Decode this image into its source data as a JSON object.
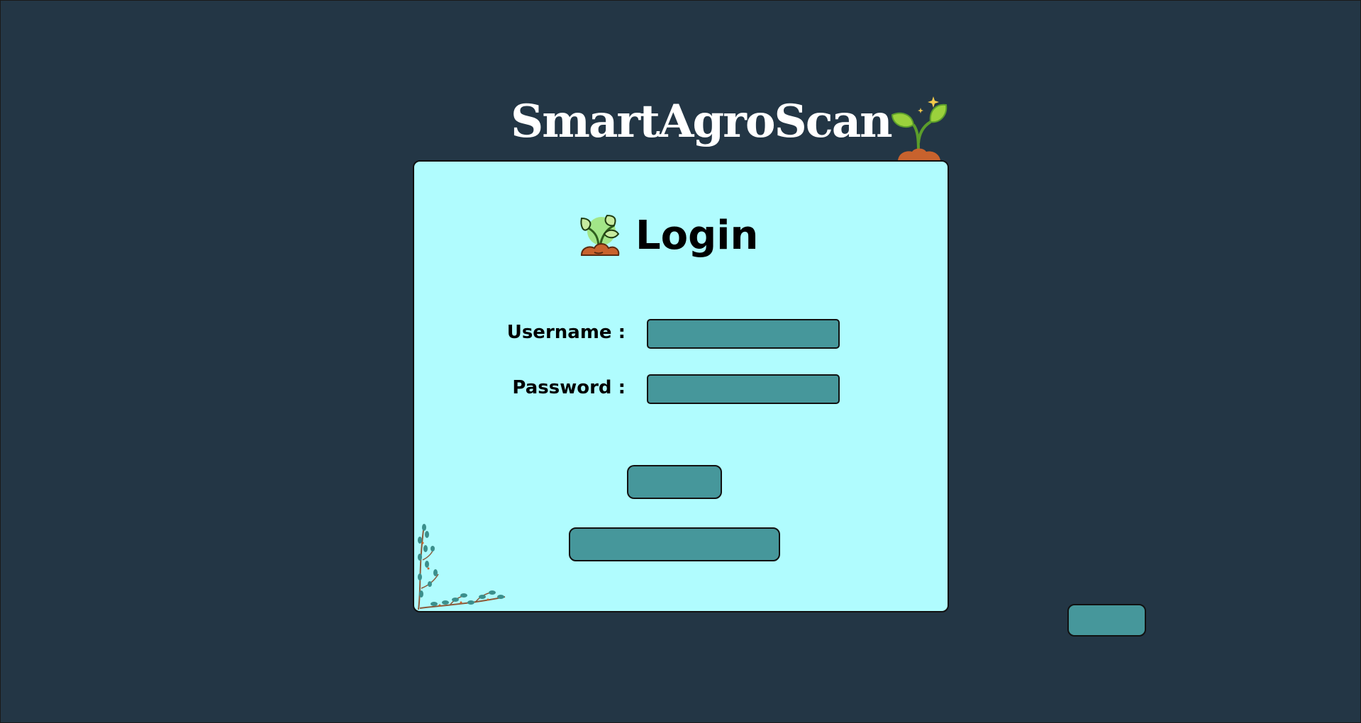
{
  "app": {
    "title": "SmartAgroScan"
  },
  "login_form": {
    "heading": "Login",
    "username_label": "Username :",
    "username_value": "",
    "password_label": "Password :",
    "password_value": "",
    "login_button_label": "",
    "register_button_label": ""
  },
  "corner_button": {
    "label": ""
  },
  "icons": {
    "title_decoration": "sprout-icon",
    "heading_decoration": "plant-soil-icon",
    "card_decoration": "branch-icon"
  },
  "colors": {
    "page_background": "#233645",
    "card_background": "#b0fcfe",
    "control_fill": "#46979b",
    "title_text": "#ffffff"
  }
}
